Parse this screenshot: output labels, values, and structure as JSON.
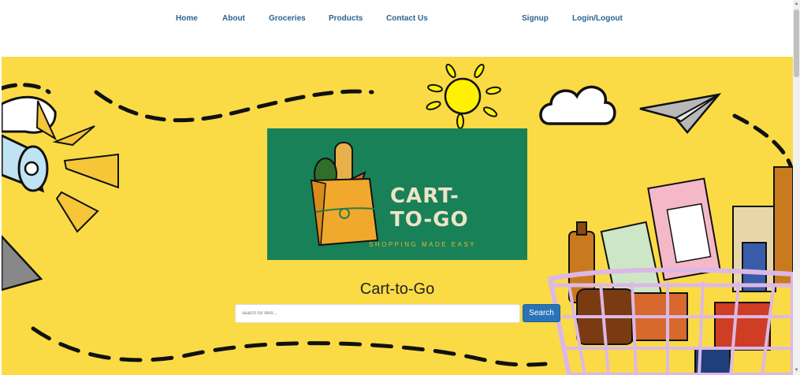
{
  "nav": {
    "items": [
      {
        "label": "Home"
      },
      {
        "label": "About"
      },
      {
        "label": "Groceries"
      },
      {
        "label": "Products"
      },
      {
        "label": "Contact Us"
      }
    ],
    "right": [
      {
        "label": "Signup"
      },
      {
        "label": "Login/Logout"
      }
    ]
  },
  "hero": {
    "logo": {
      "line1": "CART-",
      "line2": "TO-GO",
      "tagline": "SHOPPING MADE EASY"
    },
    "title": "Cart-to-Go",
    "search": {
      "placeholder": "search for item...",
      "value": "",
      "button_label": "Search"
    }
  },
  "colors": {
    "hero_bg": "#fadb46",
    "logo_bg": "#188157",
    "nav_link": "#2a6496",
    "button": "#2a73b8"
  },
  "icons": [
    "sun-icon",
    "cloud-icon",
    "paper-plane-icon",
    "megaphone-icon",
    "shopping-cart-icon",
    "grocery-bag-icon"
  ]
}
